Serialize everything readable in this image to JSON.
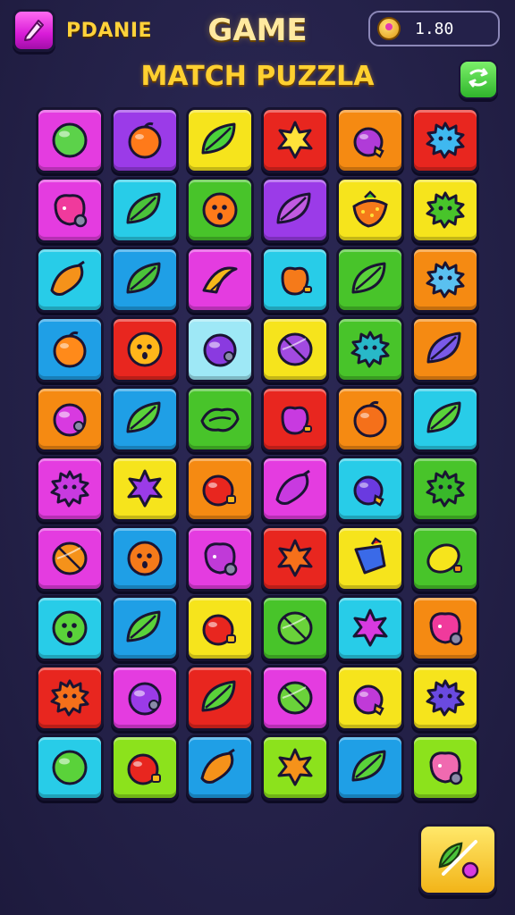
{
  "header": {
    "player_name": "PDANIE",
    "title": "GAME",
    "coins": "1.80",
    "subtitle": "MATCH PUZZLA"
  },
  "icons": {
    "menu": "pencil-icon",
    "coin": "coin-icon",
    "shuffle": "shuffle-icon",
    "tool": "leaf-tool-icon"
  },
  "colors": {
    "magenta": "#e43ce0",
    "purple": "#9b3be8",
    "yellow": "#f6e41c",
    "red": "#e8261f",
    "orange": "#f58a12",
    "cyan": "#28cce8",
    "sky": "#1f9fe6",
    "green": "#48c42a",
    "lime": "#8ce21c",
    "pale": "#9ee8f6",
    "pink": "#f23fa8"
  },
  "board": [
    [
      {
        "bg": "magenta",
        "fruit": "ball",
        "fc": "#5cd24a"
      },
      {
        "bg": "purple",
        "fruit": "orange",
        "fc": "#ff7a1a"
      },
      {
        "bg": "yellow",
        "fruit": "leaf",
        "fc": "#4bd23a"
      },
      {
        "bg": "red",
        "fruit": "star",
        "fc": "#ffe23a"
      },
      {
        "bg": "orange",
        "fruit": "grape",
        "fc": "#b03bd8"
      },
      {
        "bg": "red",
        "fruit": "spiky",
        "fc": "#3fb8f0"
      }
    ],
    [
      {
        "bg": "magenta",
        "fruit": "berry",
        "fc": "#f03a9c"
      },
      {
        "bg": "cyan",
        "fruit": "leaf",
        "fc": "#4bc23a"
      },
      {
        "bg": "green",
        "fruit": "face",
        "fc": "#ff7a1a"
      },
      {
        "bg": "purple",
        "fruit": "leaf",
        "fc": "#c05ae0"
      },
      {
        "bg": "yellow",
        "fruit": "strawberry",
        "fc": "#f57a1a"
      },
      {
        "bg": "yellow",
        "fruit": "spiky",
        "fc": "#48c42a"
      }
    ],
    [
      {
        "bg": "cyan",
        "fruit": "mango",
        "fc": "#f5921a"
      },
      {
        "bg": "sky",
        "fruit": "leaf",
        "fc": "#4bc23a"
      },
      {
        "bg": "magenta",
        "fruit": "banana",
        "fc": "#f5b81a"
      },
      {
        "bg": "cyan",
        "fruit": "apple",
        "fc": "#f57a1a"
      },
      {
        "bg": "green",
        "fruit": "leaf",
        "fc": "#5ad23a"
      },
      {
        "bg": "orange",
        "fruit": "spiky",
        "fc": "#5ac0f0"
      }
    ],
    [
      {
        "bg": "sky",
        "fruit": "orange",
        "fc": "#ff8a1a"
      },
      {
        "bg": "red",
        "fruit": "face",
        "fc": "#ffb61a"
      },
      {
        "bg": "pale",
        "fruit": "plum",
        "fc": "#8a3ae0"
      },
      {
        "bg": "yellow",
        "fruit": "melon",
        "fc": "#a24ae0"
      },
      {
        "bg": "green",
        "fruit": "spiky",
        "fc": "#28b8c8"
      },
      {
        "bg": "orange",
        "fruit": "leaf",
        "fc": "#7a5ae8"
      }
    ],
    [
      {
        "bg": "orange",
        "fruit": "plum",
        "fc": "#d83ae0"
      },
      {
        "bg": "sky",
        "fruit": "leaf",
        "fc": "#5ad23a"
      },
      {
        "bg": "green",
        "fruit": "pea",
        "fc": "#48c42a"
      },
      {
        "bg": "red",
        "fruit": "apple",
        "fc": "#c83ae0"
      },
      {
        "bg": "orange",
        "fruit": "orange",
        "fc": "#f5701a"
      },
      {
        "bg": "cyan",
        "fruit": "leaf",
        "fc": "#5ad23a"
      }
    ],
    [
      {
        "bg": "magenta",
        "fruit": "spiky",
        "fc": "#c83ae0"
      },
      {
        "bg": "yellow",
        "fruit": "star",
        "fc": "#9b3be8"
      },
      {
        "bg": "orange",
        "fruit": "cherry",
        "fc": "#e8261f"
      },
      {
        "bg": "magenta",
        "fruit": "mango",
        "fc": "#c83ae0"
      },
      {
        "bg": "cyan",
        "fruit": "grape",
        "fc": "#6a3ae0"
      },
      {
        "bg": "green",
        "fruit": "spiky",
        "fc": "#38b82a"
      }
    ],
    [
      {
        "bg": "magenta",
        "fruit": "melon",
        "fc": "#f5921a"
      },
      {
        "bg": "sky",
        "fruit": "face",
        "fc": "#f57a1a"
      },
      {
        "bg": "magenta",
        "fruit": "berry",
        "fc": "#c03ad8"
      },
      {
        "bg": "red",
        "fruit": "star",
        "fc": "#f5701a"
      },
      {
        "bg": "yellow",
        "fruit": "blue",
        "fc": "#3a6ae8"
      },
      {
        "bg": "green",
        "fruit": "lemon",
        "fc": "#f6e41c"
      }
    ],
    [
      {
        "bg": "cyan",
        "fruit": "face",
        "fc": "#5ad23a"
      },
      {
        "bg": "sky",
        "fruit": "leaf",
        "fc": "#5ad23a"
      },
      {
        "bg": "yellow",
        "fruit": "cherry",
        "fc": "#e8261f"
      },
      {
        "bg": "green",
        "fruit": "melon",
        "fc": "#6ad23a"
      },
      {
        "bg": "cyan",
        "fruit": "star",
        "fc": "#d83ae0"
      },
      {
        "bg": "orange",
        "fruit": "berry",
        "fc": "#f03a9c"
      }
    ],
    [
      {
        "bg": "red",
        "fruit": "spiky",
        "fc": "#f5701a"
      },
      {
        "bg": "magenta",
        "fruit": "plum",
        "fc": "#9b3be8"
      },
      {
        "bg": "red",
        "fruit": "leaf",
        "fc": "#5ad23a"
      },
      {
        "bg": "magenta",
        "fruit": "melon",
        "fc": "#6ad23a"
      },
      {
        "bg": "yellow",
        "fruit": "grape",
        "fc": "#c03ad8"
      },
      {
        "bg": "yellow",
        "fruit": "spiky",
        "fc": "#6a4ae0"
      }
    ],
    [
      {
        "bg": "cyan",
        "fruit": "ball",
        "fc": "#5ad23a"
      },
      {
        "bg": "lime",
        "fruit": "cherry",
        "fc": "#e8261f"
      },
      {
        "bg": "sky",
        "fruit": "mango",
        "fc": "#f5921a"
      },
      {
        "bg": "lime",
        "fruit": "star",
        "fc": "#f5921a"
      },
      {
        "bg": "sky",
        "fruit": "leaf",
        "fc": "#5ad23a"
      },
      {
        "bg": "lime",
        "fruit": "berry",
        "fc": "#f06ab0"
      }
    ]
  ]
}
